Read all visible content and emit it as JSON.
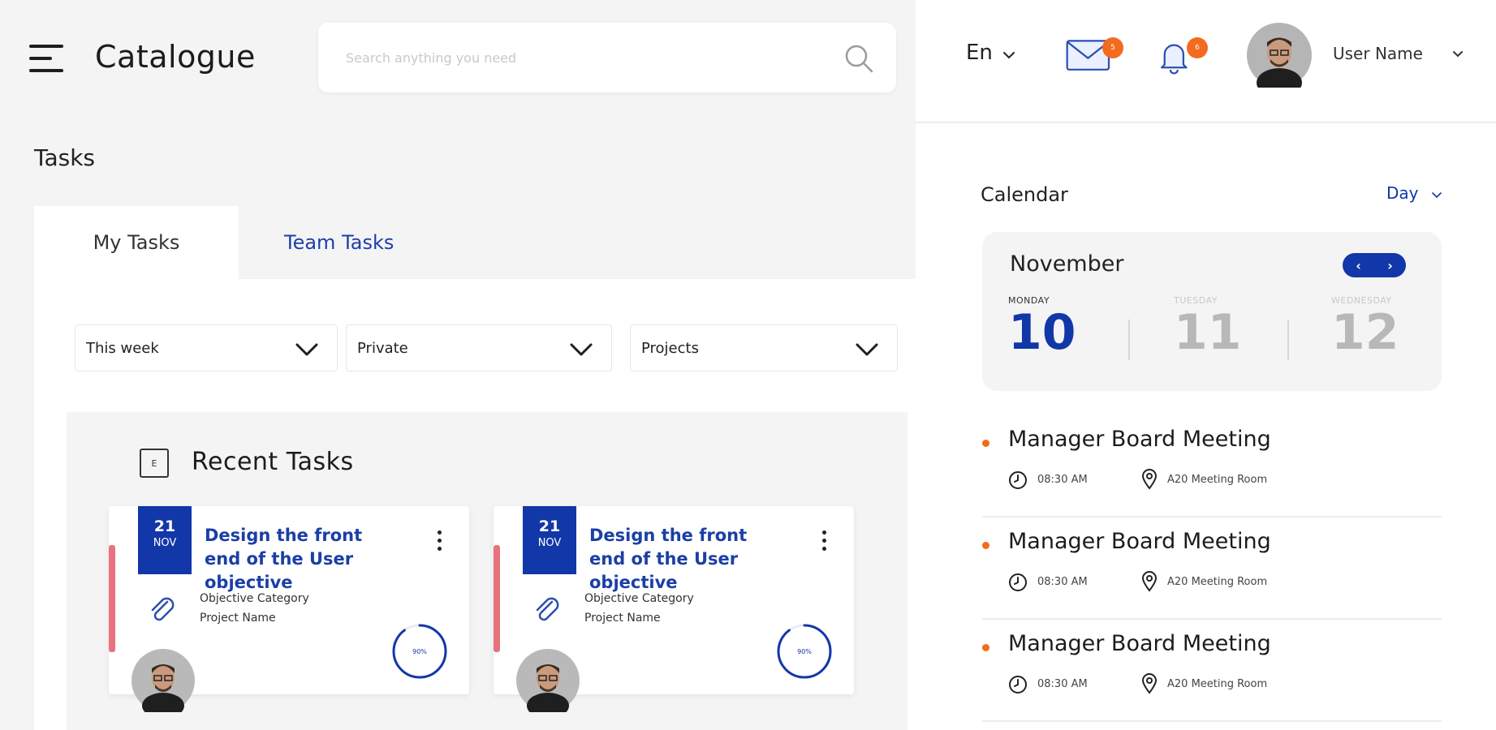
{
  "header": {
    "app_title": "Catalogue",
    "search_placeholder": "Search anything you need"
  },
  "tasks": {
    "heading": "Tasks",
    "tabs": [
      {
        "label": "My Tasks",
        "active": true
      },
      {
        "label": "Team Tasks",
        "active": false
      }
    ],
    "filters": [
      {
        "value": "This week"
      },
      {
        "value": "Private"
      },
      {
        "value": "Projects"
      }
    ],
    "recent": {
      "title": "Recent Tasks",
      "icon_label": "E",
      "cards": [
        {
          "date_day": "21",
          "date_month": "NOV",
          "title": "Design the front end of the User objective",
          "category": "Objective Category",
          "project": "Project Name",
          "progress_label": "90%",
          "progress": 0.9
        },
        {
          "date_day": "21",
          "date_month": "NOV",
          "title": "Design the front end of the User objective",
          "category": "Objective Category",
          "project": "Project Name",
          "progress_label": "90%",
          "progress": 0.9
        }
      ]
    }
  },
  "topbar": {
    "language": "En",
    "mail_badge": "5",
    "notifications_badge": "6",
    "user_name": "User Name"
  },
  "calendar": {
    "heading": "Calendar",
    "view": "Day",
    "month": "November",
    "days": [
      {
        "weekday": "MONDAY",
        "number": "10",
        "active": true
      },
      {
        "weekday": "TUESDAY",
        "number": "11",
        "active": false
      },
      {
        "weekday": "WEDNESDAY",
        "number": "12",
        "active": false
      }
    ],
    "events": [
      {
        "title": "Manager Board Meeting",
        "time": "08:30 AM",
        "location": "A20 Meeting Room"
      },
      {
        "title": "Manager Board Meeting",
        "time": "08:30 AM",
        "location": "A20 Meeting Room"
      },
      {
        "title": "Manager Board Meeting",
        "time": "08:30 AM",
        "location": "A20 Meeting Room"
      }
    ]
  },
  "colors": {
    "primary": "#1237a8",
    "accent_orange": "#f26b1f",
    "card_accent": "#e8737d",
    "background": "#f4f4f5"
  },
  "icons": [
    "hamburger-menu-icon",
    "search-icon",
    "chevron-down-icon",
    "paperclip-icon",
    "mail-icon",
    "bell-icon",
    "clock-icon",
    "location-pin-icon"
  ]
}
